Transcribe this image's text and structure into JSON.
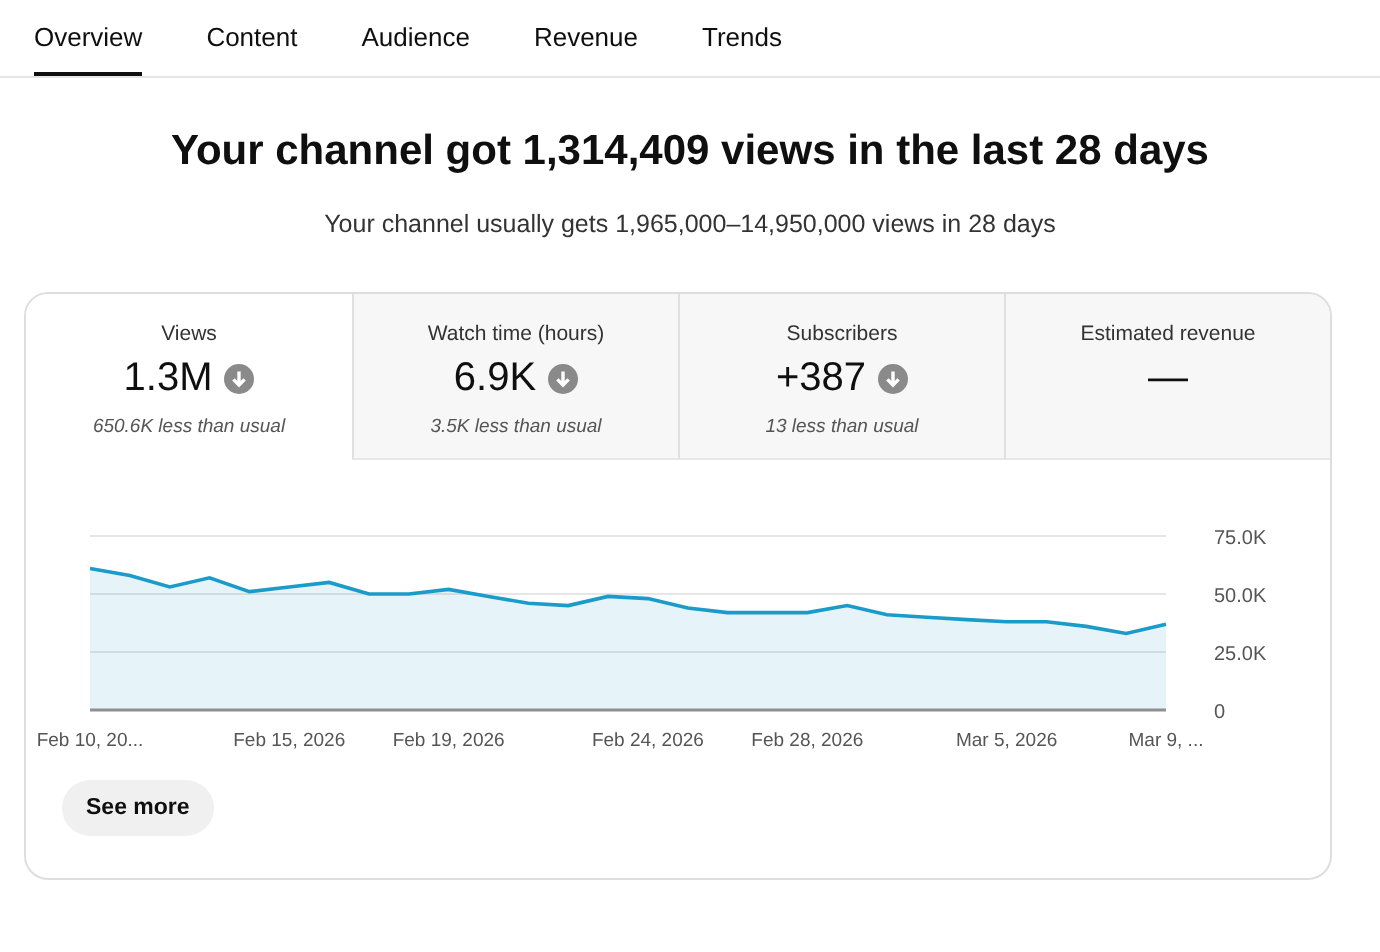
{
  "tabs": [
    {
      "label": "Overview",
      "selected": true
    },
    {
      "label": "Content",
      "selected": false
    },
    {
      "label": "Audience",
      "selected": false
    },
    {
      "label": "Revenue",
      "selected": false
    },
    {
      "label": "Trends",
      "selected": false
    }
  ],
  "headline": "Your channel got 1,314,409 views in the last 28 days",
  "subtitle": "Your channel usually gets 1,965,000–14,950,000 views in 28 days",
  "metrics": [
    {
      "label": "Views",
      "value": "1.3M",
      "arrow": true,
      "note": "650.6K less than usual",
      "selected": true
    },
    {
      "label": "Watch time (hours)",
      "value": "6.9K",
      "arrow": true,
      "note": "3.5K less than usual",
      "selected": false
    },
    {
      "label": "Subscribers",
      "value": "+387",
      "arrow": true,
      "note": "13 less than usual",
      "selected": false
    },
    {
      "label": "Estimated revenue",
      "value": "—",
      "selected": false
    }
  ],
  "chart": {
    "chart_data": {
      "type": "area",
      "categories": [
        "Feb 10, 20...",
        null,
        null,
        null,
        null,
        "Feb 15, 2026",
        null,
        null,
        null,
        "Feb 19, 2026",
        null,
        null,
        null,
        null,
        "Feb 24, 2026",
        null,
        null,
        null,
        "Feb 28, 2026",
        null,
        null,
        null,
        null,
        "Mar 5, 2026",
        null,
        null,
        null,
        "Mar 9, ..."
      ],
      "series": [
        {
          "color": "#1a9bc9",
          "values": [
            61000,
            58000,
            53000,
            57000,
            51000,
            53000,
            55000,
            50000,
            50000,
            52000,
            49000,
            46000,
            45000,
            49000,
            48000,
            44000,
            42000,
            42000,
            42000,
            45000,
            41000,
            40000,
            39000,
            38000,
            38000,
            36000,
            33000,
            37000
          ]
        }
      ],
      "ylim": [
        0,
        75000
      ],
      "yticks": [
        {
          "value": 0,
          "label": "0"
        },
        {
          "value": 25000,
          "label": "25.0K"
        },
        {
          "value": 50000,
          "label": "50.0K"
        },
        {
          "value": 75000,
          "label": "75.0K"
        }
      ]
    }
  },
  "see_more": "See more"
}
